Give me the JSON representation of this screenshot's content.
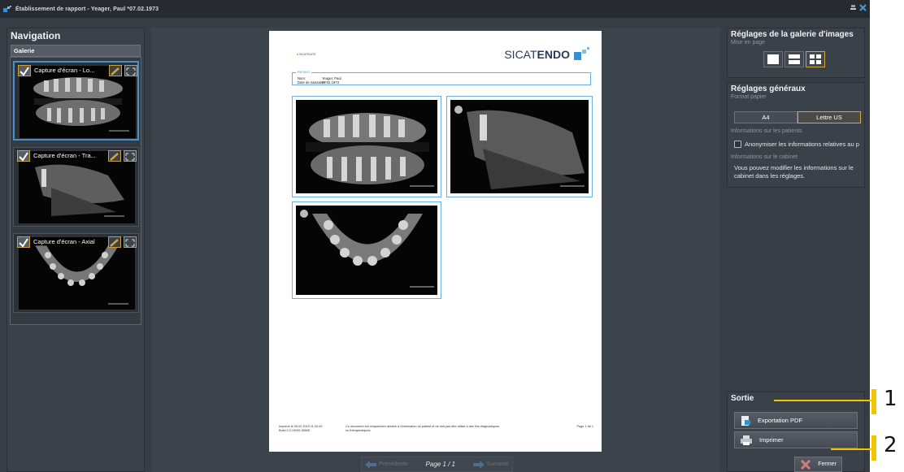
{
  "window": {
    "title": "Établissement de rapport - Yeager, Paul *07.02.1973"
  },
  "navigation": {
    "title": "Navigation",
    "gallery_header": "Galerie",
    "items": [
      {
        "label": "Capture d'écran - Lo..."
      },
      {
        "label": "Capture d'écran - Tra..."
      },
      {
        "label": "Capture d'écran - Axial"
      }
    ]
  },
  "document": {
    "logo_left": "SICATSUITE",
    "logo_right_prefix": "SICAT",
    "logo_right_suffix": "ENDO",
    "patient_legend": "PATIENT",
    "name_label": "Nom:",
    "name_value": "Yeager, Paul",
    "dob_label": "Date de naissance:",
    "dob_value": "07.02.1973",
    "scale_label": "1 cm",
    "footer_printed": "Imprimé le 26.02.2019 11:20:49",
    "footer_build": "Build 2.0.19039.38665",
    "footer_disclaimer_1": "Ce document est uniquement destiné à l'information du patient et ne doit pas être utilisé à des fins diagnostiques",
    "footer_disclaimer_2": "ou thérapeutiques.",
    "footer_page": "Page 1 de 1"
  },
  "pager": {
    "prev": "Précédente",
    "indicator": "Page 1 / 1",
    "next": "Suivante"
  },
  "gallery_settings": {
    "title": "Réglages de la galerie d'images",
    "layout_label": "Mise en page"
  },
  "general_settings": {
    "title": "Réglages généraux",
    "paper_format_label": "Format papier",
    "paper_a4": "A4",
    "paper_letter": "Lettre US",
    "patient_info_label": "Informations sur les patients",
    "anonymize_label": "Anonymiser les informations relatives au p",
    "anonymize_checked": false,
    "practice_info_label": "Informations sur le cabinet",
    "practice_info_text": "Vous pouvez modifier les informations sur le cabinet dans les réglages."
  },
  "output": {
    "title": "Sortie",
    "export_pdf": "Exportation PDF",
    "print": "Imprimer",
    "close": "Fermer"
  },
  "callouts": {
    "one": "1",
    "two": "2"
  },
  "colors": {
    "accent": "#d6a73c",
    "selection": "#4a90c8",
    "callout": "#f5c400"
  }
}
